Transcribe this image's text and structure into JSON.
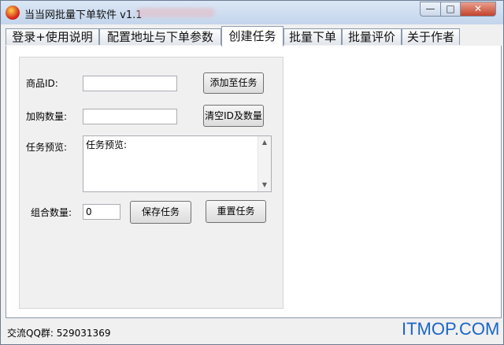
{
  "window": {
    "title": "当当网批量下单软件 v1.1",
    "controls": {
      "minimize": "—",
      "maximize": "□",
      "close": "✕"
    }
  },
  "tabs": [
    {
      "label": "登录+使用说明"
    },
    {
      "label": "配置地址与下单参数"
    },
    {
      "label": "创建任务",
      "active": true
    },
    {
      "label": "批量下单"
    },
    {
      "label": "批量评价"
    },
    {
      "label": "关于作者"
    }
  ],
  "form": {
    "product_id_label": "商品ID:",
    "product_id_value": "",
    "add_to_task_button": "添加至任务",
    "quantity_label": "加购数量:",
    "quantity_value": "",
    "clear_button": "清空ID及数量",
    "preview_label": "任务预览:",
    "preview_text": "任务预览:",
    "combo_count_label": "组合数量:",
    "combo_count_value": "0",
    "save_task_button": "保存任务",
    "reset_task_button": "重置任务"
  },
  "status": {
    "qq_group": "交流QQ群: 529031369"
  },
  "watermark": "ITMOP.COM",
  "colors": {
    "title_gradient_top": "#dbe7f5",
    "close_button": "#c3432b",
    "watermark": "#1a66c7"
  },
  "icons": {
    "app": "app-logo-icon",
    "scroll_up": "scroll-up-arrow-icon",
    "scroll_down": "scroll-down-arrow-icon"
  }
}
